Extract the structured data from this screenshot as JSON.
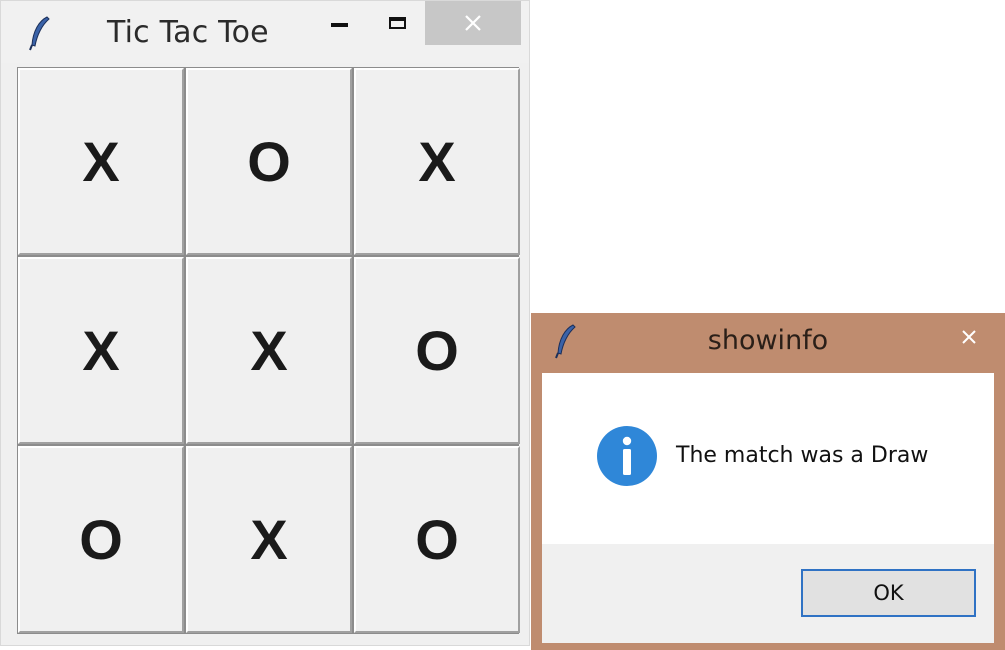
{
  "main_window": {
    "title": "Tic Tac Toe",
    "icon": "feather-icon",
    "controls": [
      "minimize-icon",
      "maximize-icon",
      "close-icon"
    ]
  },
  "board": {
    "cells": [
      "X",
      "O",
      "X",
      "X",
      "X",
      "O",
      "O",
      "X",
      "O"
    ]
  },
  "dialog": {
    "title": "showinfo",
    "icon": "feather-icon",
    "message_icon": "info-icon",
    "message": "The match was a Draw",
    "ok_label": "OK",
    "colors": {
      "frame": "#bf8c6f",
      "info_icon": "#2f87d8",
      "ok_border": "#2f72c4"
    }
  }
}
